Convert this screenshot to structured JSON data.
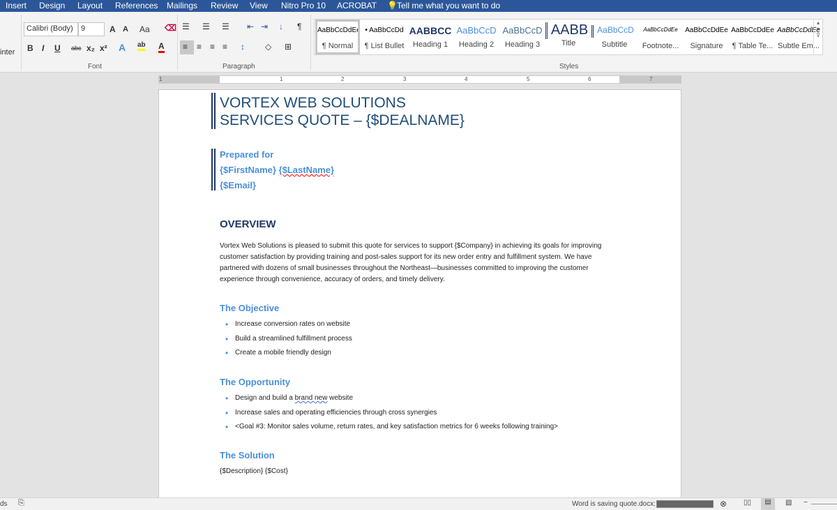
{
  "tabs": [
    "Insert",
    "Design",
    "Layout",
    "References",
    "Mailings",
    "Review",
    "View",
    "Nitro Pro 10",
    "ACROBAT"
  ],
  "tell_me": "Tell me what you want to do",
  "clipboard_partial": "inter",
  "font": {
    "name": "Calibri (Body)",
    "size": "9",
    "group_label": "Font",
    "bold": "B",
    "italic": "I",
    "underline": "U",
    "strike": "abc",
    "sub": "x₂",
    "sup": "x²",
    "change_case": "Aa",
    "grow": "A",
    "shrink": "A",
    "color": "A",
    "highlight": "ab"
  },
  "paragraph": {
    "group_label": "Paragraph",
    "pilcrow": "¶"
  },
  "styles": {
    "group_label": "Styles",
    "items": [
      {
        "preview": "AaBbCcDdEe",
        "name": "¶ Normal"
      },
      {
        "preview": "• AaBbCcDd",
        "name": "¶ List Bullet"
      },
      {
        "preview": "AABBCC",
        "name": "Heading 1"
      },
      {
        "preview": "AaBbCcD",
        "name": "Heading 2"
      },
      {
        "preview": "AaBbCcD",
        "name": "Heading 3"
      },
      {
        "preview": "AABB",
        "name": "Title"
      },
      {
        "preview": "AaBbCcD",
        "name": "Subtitle"
      },
      {
        "preview": "AaBbCcDdEe",
        "name": "Footnote..."
      },
      {
        "preview": "AaBbCcDdEe",
        "name": "Signature"
      },
      {
        "preview": "AaBbCcDdEe",
        "name": "¶ Table Te..."
      },
      {
        "preview": "AaBbCcDdEe",
        "name": "Subtle Em..."
      }
    ]
  },
  "ruler": [
    "1",
    "1",
    "2",
    "3",
    "4",
    "5",
    "6",
    "7"
  ],
  "doc": {
    "title1": "VORTEX WEB SOLUTIONS",
    "title2": "SERVICES QUOTE – {$DEALNAME}",
    "prepared_for": "Prepared for",
    "first": "{$FirstName} ",
    "last": "{$LastName}",
    "email": "{$Email}",
    "overview_heading": "OVERVIEW",
    "overview_text": "Vortex Web Solutions is pleased to submit this quote for services to support {$Company} in achieving its goals for improving customer satisfaction by providing training and post-sales support for its new order entry and fulfillment system. We have partnered with dozens of small businesses throughout the Northeast—businesses committed to improving the customer experience through convenience, accuracy of orders, and timely delivery.",
    "objective_heading": "The Objective",
    "objective_items": [
      "Increase conversion rates on website",
      "Build a streamlined fulfillment process",
      "Create a mobile friendly design"
    ],
    "opportunity_heading": "The Opportunity",
    "opp1_a": "Design and build a ",
    "opp1_b": "brand new",
    "opp1_c": " website",
    "opp2": "Increase sales and operating efficiencies through cross synergies",
    "opp3": "<Goal #3: Monitor sales volume, return rates, and key satisfaction metrics for 6 weeks following training>",
    "solution_heading": "The Solution",
    "solution_text": "{$Description} {$Cost}"
  },
  "status": {
    "left": "ds",
    "saving": "Word is saving quote.docx:",
    "progress": 1.0
  }
}
